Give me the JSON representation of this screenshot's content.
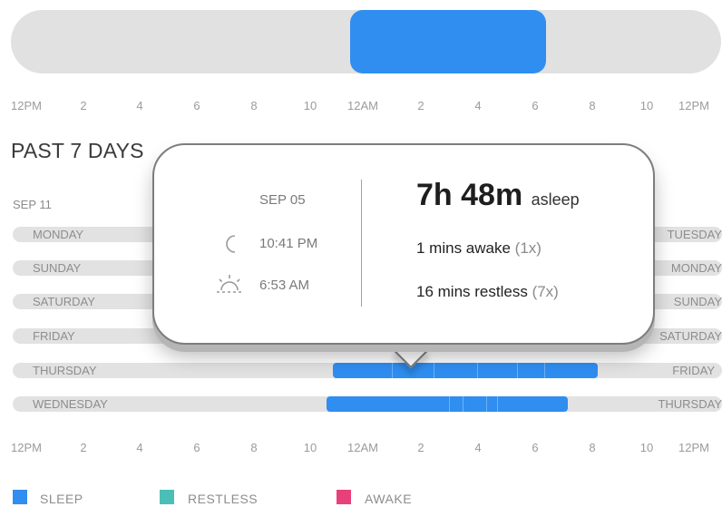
{
  "axis_labels": [
    "12PM",
    "2",
    "4",
    "6",
    "8",
    "10",
    "12AM",
    "2",
    "4",
    "6",
    "8",
    "10",
    "12PM"
  ],
  "section_title": "PAST 7 DAYS",
  "date_label": "SEP 11",
  "days": [
    {
      "label": "MONDAY",
      "right_label": "TUESDAY"
    },
    {
      "label": "SUNDAY",
      "right_label": "MONDAY"
    },
    {
      "label": "SATURDAY",
      "right_label": "SUNDAY"
    },
    {
      "label": "FRIDAY",
      "right_label": "SATURDAY"
    },
    {
      "label": "THURSDAY",
      "right_label": "FRIDAY"
    },
    {
      "label": "WEDNESDAY",
      "right_label": "THURSDAY"
    }
  ],
  "tooltip": {
    "date": "SEP 05",
    "bedtime": "10:41 PM",
    "wake_time": "6:53 AM",
    "duration": "7h 48m",
    "duration_unit": "asleep",
    "awake_text": "1 mins awake",
    "awake_count": "(1x)",
    "restless_text": "16 mins restless",
    "restless_count": "(7x)"
  },
  "legend": [
    {
      "label": "SLEEP",
      "color": "#2f8ef0"
    },
    {
      "label": "RESTLESS",
      "color": "#4bbfb5"
    },
    {
      "label": "AWAKE",
      "color": "#e8407a"
    }
  ],
  "colors": {
    "sleep": "#2f8ef0",
    "track": "#e2e2e2"
  },
  "icons": {
    "bedtime": "moon-icon",
    "wake": "sunrise-icon"
  }
}
